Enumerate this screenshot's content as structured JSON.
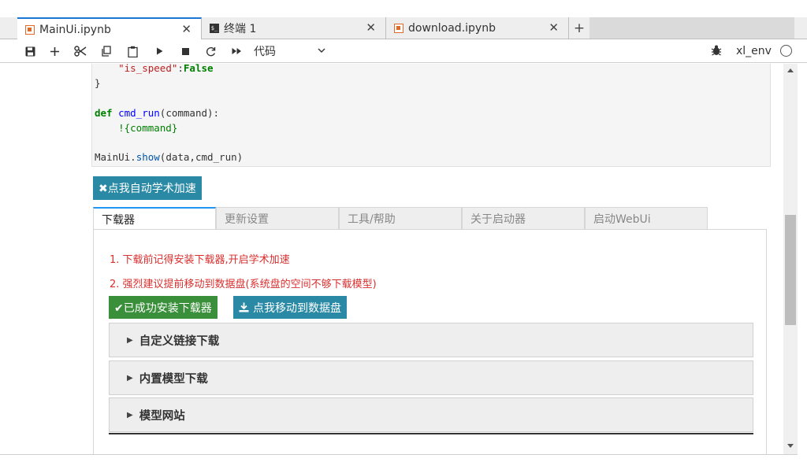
{
  "tabs": [
    {
      "label": "MainUi.ipynb",
      "icon": "notebook-icon"
    },
    {
      "label": "终端 1",
      "icon": "terminal-icon"
    },
    {
      "label": "download.ipynb",
      "icon": "notebook-icon"
    }
  ],
  "tab_close": "✕",
  "tab_add": "+",
  "toolbar": {
    "cell_type": "代码",
    "kernel_name": "xl_env"
  },
  "code": {
    "line1_key": "\"is_speed\"",
    "line1_sep": ":",
    "line1_val": "False",
    "line2": "}",
    "def_kw": "def",
    "def_name": "cmd_run",
    "def_args": "(command):",
    "body": "    !{command}",
    "call_obj": "MainUi.",
    "call_fn": "show",
    "call_args": "(data,cmd_run)"
  },
  "speed_button": "✖点我自动学术加速",
  "widget_tabs": [
    "下载器",
    "更新设置",
    "工具/帮助",
    "关于启动器",
    "启动WebUi"
  ],
  "notes": [
    "1. 下载前记得安装下载器,开启学术加速",
    "2. 强烈建议提前移动到数据盘(系统盘的空间不够下载模型)"
  ],
  "installed_button": "✔已成功安装下载器",
  "move_button": "点我移动到数据盘",
  "accordions": [
    "自定义链接下载",
    "内置模型下载",
    "模型网站"
  ],
  "colors": {
    "accent": "#1976d2",
    "info_button": "#2a8aa6",
    "success_button": "#3a8f3a",
    "warning_text": "#d9302f"
  }
}
